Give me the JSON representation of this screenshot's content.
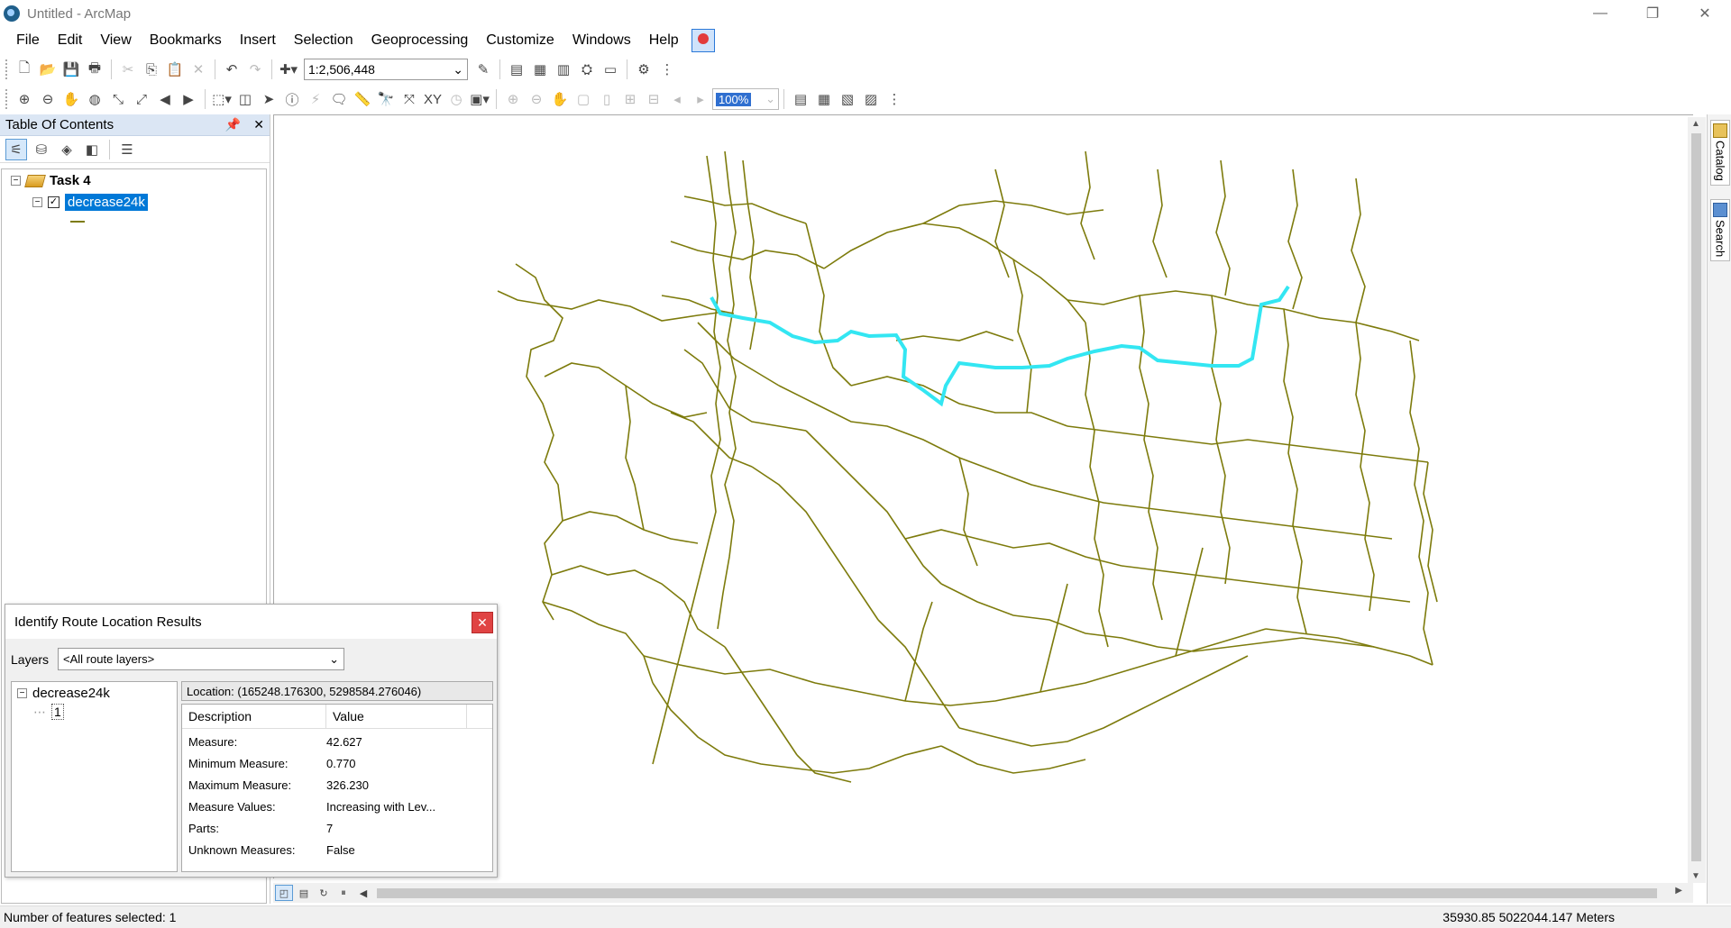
{
  "window": {
    "title": "Untitled - ArcMap",
    "controls": [
      "—",
      "❐",
      "✕"
    ]
  },
  "menu": {
    "items": [
      "File",
      "Edit",
      "View",
      "Bookmarks",
      "Insert",
      "Selection",
      "Geoprocessing",
      "Customize",
      "Windows",
      "Help"
    ]
  },
  "toolbar": {
    "scale": "1:2,506,448",
    "zoom_percent": "100%"
  },
  "toc": {
    "title": "Table Of Contents",
    "dataframe": "Task 4",
    "layer": "decrease24k",
    "layer_checked": true
  },
  "identify": {
    "title": "Identify Route Location Results",
    "layers_label": "Layers",
    "layers_value": "<All route layers>",
    "tree_layer": "decrease24k",
    "tree_feature": "1",
    "location": "Location: (165248.176300, 5298584.276046)",
    "col_description": "Description",
    "col_value": "Value",
    "rows": [
      {
        "desc": "Measure:",
        "val": "42.627"
      },
      {
        "desc": "Minimum Measure:",
        "val": "0.770"
      },
      {
        "desc": "Maximum Measure:",
        "val": "326.230"
      },
      {
        "desc": "Measure Values:",
        "val": "Increasing with Lev..."
      },
      {
        "desc": "Parts:",
        "val": "7"
      },
      {
        "desc": "Unknown Measures:",
        "val": "False"
      }
    ]
  },
  "side_tabs": {
    "catalog": "Catalog",
    "search": "Search"
  },
  "status": {
    "selected": "Number of features selected: 1",
    "coordinates": "35930.85  5022044.147 Meters"
  },
  "colors": {
    "roads": "#7d7b0c",
    "highlight": "#33e6f2",
    "selection": "#0078d7"
  }
}
